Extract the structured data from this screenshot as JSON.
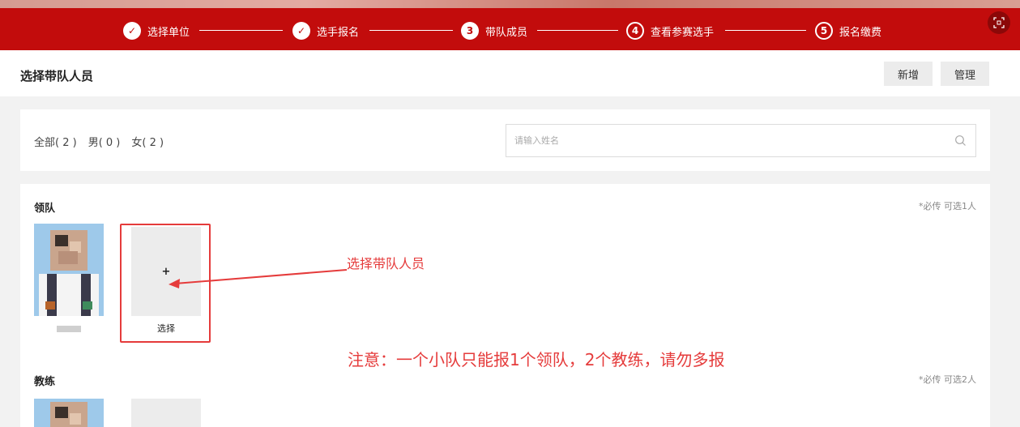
{
  "steps": [
    {
      "label": "选择单位",
      "state": "done",
      "marker": "✓"
    },
    {
      "label": "选手报名",
      "state": "done",
      "marker": "✓"
    },
    {
      "label": "带队成员",
      "state": "active",
      "marker": "3"
    },
    {
      "label": "查看参赛选手",
      "state": "todo",
      "marker": "4"
    },
    {
      "label": "报名缴费",
      "state": "todo",
      "marker": "5"
    }
  ],
  "page": {
    "title": "选择带队人员",
    "add_button": "新增",
    "manage_button": "管理"
  },
  "filter": {
    "tabs": [
      "全部( 2 )",
      "男( 0 )",
      "女( 2 )"
    ],
    "search_placeholder": "请输入姓名"
  },
  "sections": {
    "leader": {
      "title": "领队",
      "note": "*必传 可选1人"
    },
    "coach": {
      "title": "教练",
      "note": "*必传 可选2人"
    }
  },
  "select_slot": {
    "plus": "+",
    "label": "选择"
  },
  "annotations": {
    "pointer_text": "选择带队人员",
    "warning": "注意：一个小队只能报1个领队，2个教练，请勿多报"
  },
  "colors": {
    "brand_red": "#c20c0c",
    "annotation_red": "#e53b3b"
  },
  "icons": {
    "fullscreen": "fullscreen-exit-icon",
    "search": "search-icon",
    "check": "check-icon"
  }
}
